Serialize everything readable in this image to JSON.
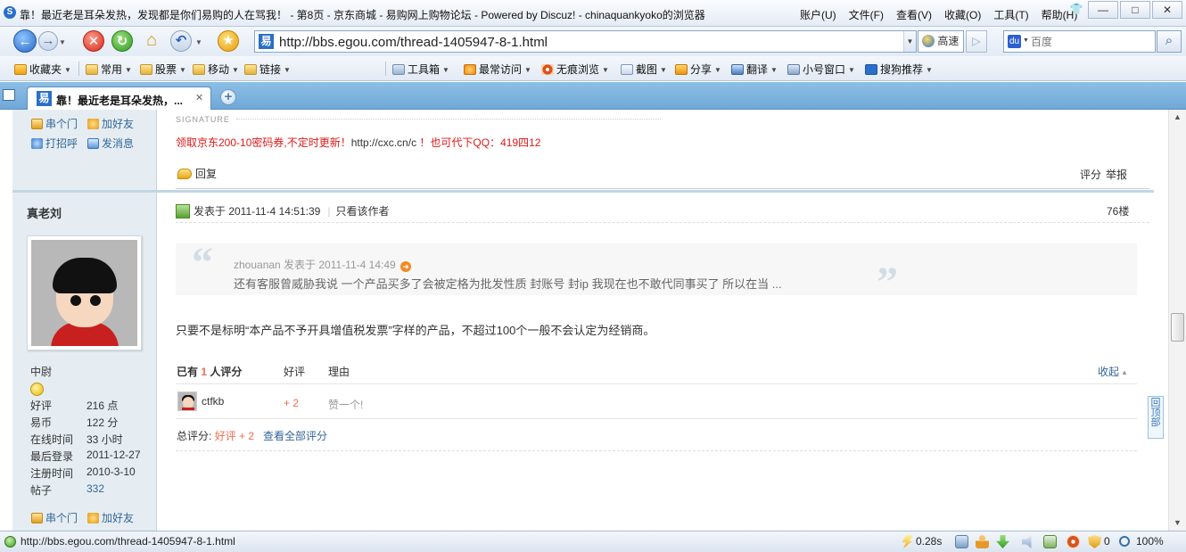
{
  "window": {
    "title": "靠！最近老是耳朵发热，发现都是你们易购的人在骂我！ - 第8页 - 京东商城 - 易购网上购物论坛 - Powered by Discuz! - chinaquankyoko的浏览器",
    "menu": [
      "账户(U)",
      "文件(F)",
      "查看(V)",
      "收藏(O)",
      "工具(T)",
      "帮助(H)"
    ],
    "controls": {
      "minimize": "—",
      "maximize": "□",
      "close": "✕"
    }
  },
  "addressbar": {
    "url": "http://bbs.egou.com/thread-1405947-8-1.html",
    "speed_label": "高速",
    "search_placeholder": "百度"
  },
  "favbar": {
    "items": [
      {
        "label": "收藏夹",
        "icon": "star-icon"
      },
      {
        "label": "常用",
        "icon": "folder-icon"
      },
      {
        "label": "股票",
        "icon": "folder-icon"
      },
      {
        "label": "移动",
        "icon": "folder-icon"
      },
      {
        "label": "链接",
        "icon": "folder-icon"
      },
      {
        "label": "工具箱",
        "icon": "toolbox-icon"
      },
      {
        "label": "最常访问",
        "icon": "frequent-icon"
      },
      {
        "label": "无痕浏览",
        "icon": "incognito-icon"
      },
      {
        "label": "截图",
        "icon": "screenshot-icon"
      },
      {
        "label": "分享",
        "icon": "share-icon"
      },
      {
        "label": "翻译",
        "icon": "translate-icon"
      },
      {
        "label": "小号窗口",
        "icon": "small-window-icon"
      },
      {
        "label": "搜狗推荐",
        "icon": "sogou-icon"
      }
    ]
  },
  "tabs": [
    {
      "label": "靠！最近老是耳朵发热，...",
      "active": true
    }
  ],
  "prev_post": {
    "side_links": [
      "串个门",
      "加好友",
      "打招呼",
      "发消息"
    ],
    "signature_label": "SIGNATURE",
    "signature_red_1": "领取京东200-10密码券,不定时更新！",
    "signature_url": "http://cxc.cn/c",
    "signature_red_2": "！也可代下QQ：419四12",
    "reply_label": "回复",
    "rate_label": "评分",
    "report_label": "举报"
  },
  "post": {
    "author": "真老刘",
    "rank": "中尉",
    "stats": [
      {
        "label": "好评",
        "value": "216 点",
        "link": false
      },
      {
        "label": "易币",
        "value": "122 分",
        "link": false
      },
      {
        "label": "在线时间",
        "value": "33 小时",
        "link": false
      },
      {
        "label": "最后登录",
        "value": "2011-12-27",
        "link": false
      },
      {
        "label": "注册时间",
        "value": "2010-3-10",
        "link": false
      },
      {
        "label": "帖子",
        "value": "332",
        "link": true
      }
    ],
    "side_links_bottom": [
      "串个门",
      "加好友"
    ],
    "posted_at": "发表于 2011-11-4 14:51:39",
    "only_author": "只看该作者",
    "floor": "76楼",
    "quote": {
      "header": "zhouanan 发表于 2011-11-4 14:49",
      "body": "还有客服曾威胁我说   一个产品买多了会被定格为批发性质   封账号  封ip  我现在也不敢代同事买了    所以在当 ...",
      "open_mark": "“",
      "close_mark": "”"
    },
    "content": "只要不是标明“本产品不予开具增值税发票”字样的产品，不超过100个一般不会认定为经销商。",
    "rating": {
      "head_prefix": "已有",
      "count": "1",
      "head_suffix": "人评分",
      "col_score": "好评",
      "col_reason": "理由",
      "collapse": "收起",
      "rows": [
        {
          "user": "ctfkb",
          "score": "+ 2",
          "reason": "赞一个!"
        }
      ],
      "total_label": "总评分:",
      "total_value": "好评 + 2",
      "view_all": "查看全部评分"
    }
  },
  "back_to_top": "回顶部",
  "statusbar": {
    "url": "http://bbs.egou.com/thread-1405947-8-1.html",
    "load_time": "0.28s",
    "block_count": "0",
    "zoom": "100%"
  }
}
